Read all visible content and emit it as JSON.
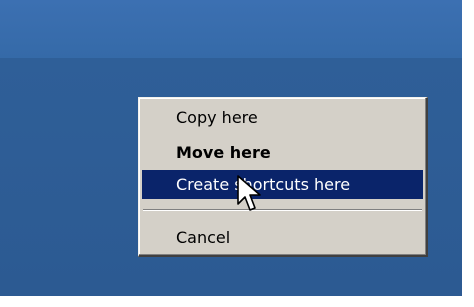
{
  "context_menu": {
    "items": [
      {
        "label": "Copy here",
        "bold": false,
        "selected": false
      },
      {
        "label": "Move here",
        "bold": true,
        "selected": false
      },
      {
        "label": "Create shortcuts here",
        "bold": false,
        "selected": true
      },
      {
        "label": "Cancel",
        "bold": false,
        "selected": false
      }
    ]
  },
  "colors": {
    "desktop": "#3a6ea5",
    "menu_background": "#d4d0c8",
    "selection_highlight": "#0a246a",
    "selection_text": "#ffffff"
  },
  "cursor": {
    "icon": "arrow-pointer-icon"
  }
}
